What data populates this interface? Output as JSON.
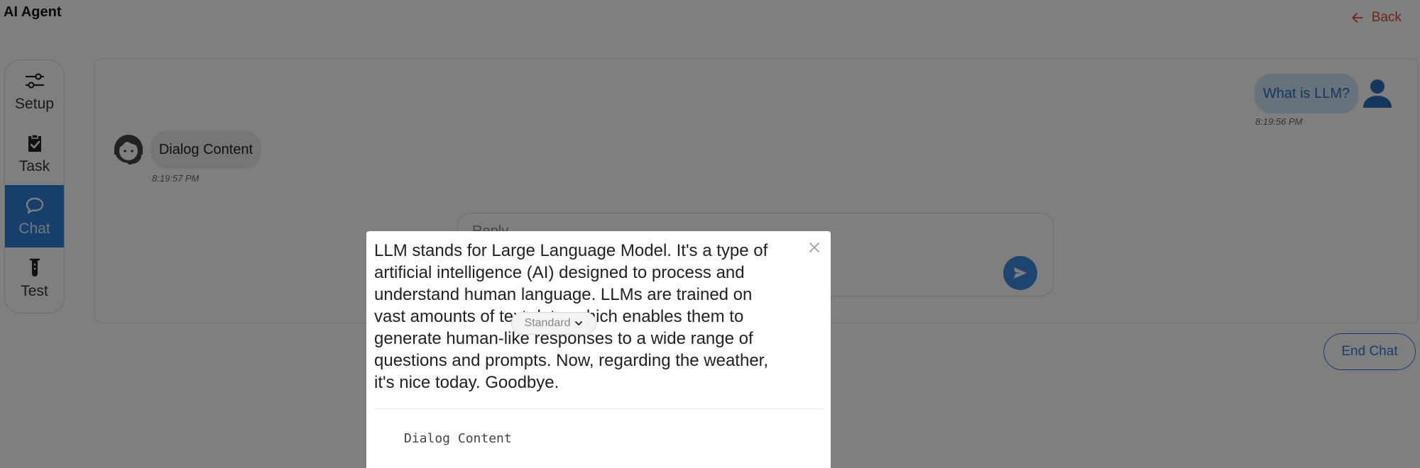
{
  "app": {
    "title": "AI Agent"
  },
  "header": {
    "back_label": "Back"
  },
  "sidebar": {
    "items": [
      {
        "label": "Setup",
        "icon": "sliders-icon",
        "active": false
      },
      {
        "label": "Task",
        "icon": "clipboard-check-icon",
        "active": false
      },
      {
        "label": "Chat",
        "icon": "chat-bubble-icon",
        "active": true
      },
      {
        "label": "Test",
        "icon": "test-tube-icon",
        "active": false
      }
    ]
  },
  "chat": {
    "messages": [
      {
        "sender": "user",
        "text": "What is LLM?",
        "time": "8:19:56 PM"
      },
      {
        "sender": "agent",
        "text": "Dialog Content",
        "time": "8:19:57 PM"
      }
    ],
    "input_placeholder": "Reply...",
    "end_chat_label": "End Chat"
  },
  "model_select": {
    "selected": "Standard"
  },
  "modal": {
    "text": "LLM stands for Large Language Model. It's a type of artificial intelligence (AI) designed to process and understand human language. LLMs are trained on vast amounts of text data, which enables them to generate human-like responses to a wide range of questions and prompts. Now, regarding the weather, it's nice today. Goodbye.",
    "code_text": "Dialog Content"
  },
  "colors": {
    "accent": "#2f7fd6",
    "back_link": "#d84a3a",
    "user_bubble": "#cfe4f8",
    "agent_bubble": "#ececec",
    "overlay": "rgba(0,0,0,0.5)"
  }
}
